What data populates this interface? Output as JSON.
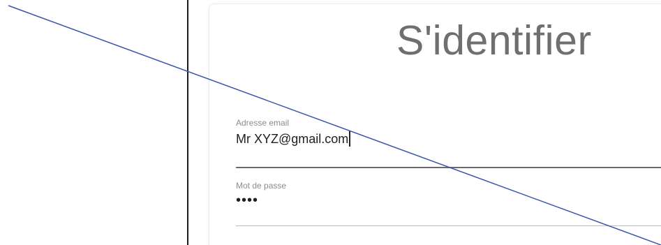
{
  "login": {
    "title": "S'identifier",
    "email_label": "Adresse email",
    "email_value": "Mr XYZ@gmail.com",
    "password_label": "Mot de passe",
    "password_masked": "••••"
  },
  "colors": {
    "title": "#6f6f6f",
    "label": "#8c8c8c",
    "text": "#202020",
    "active_underline": "#6b6b6b",
    "inactive_underline": "#bdbdbd",
    "strike_line": "#3a56a8",
    "divider": "#1a1a1a"
  }
}
